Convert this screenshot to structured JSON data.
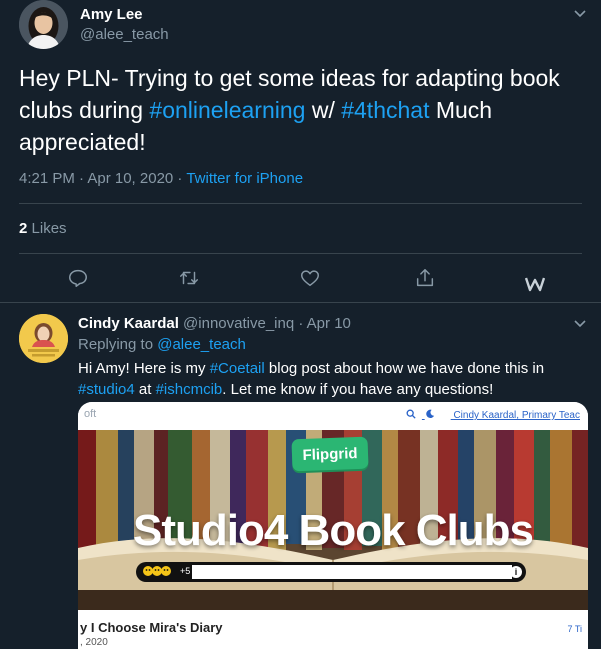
{
  "main_tweet": {
    "author_name": "Amy Lee",
    "author_handle": "@alee_teach",
    "text_parts": [
      {
        "text": "Hey PLN- Trying to get some ideas for adapting book clubs during ",
        "type": "text"
      },
      {
        "text": "#onlinelearning",
        "type": "hashtag"
      },
      {
        "text": " w/ ",
        "type": "text"
      },
      {
        "text": "#4thchat",
        "type": "hashtag"
      },
      {
        "text": " Much appreciated!",
        "type": "text"
      }
    ],
    "time": "4:21 PM · Apr 10, 2020",
    "separator": " · ",
    "source": "Twitter for iPhone",
    "likes_count": "2",
    "likes_label": "Likes",
    "actions": [
      "reply-icon",
      "retweet-icon",
      "like-icon",
      "share-icon",
      "wordpress-icon"
    ]
  },
  "reply_tweet": {
    "author_name": "Cindy Kaardal",
    "handle_and_date": "@innovative_inq · Apr 10",
    "replying_prefix": "Replying to",
    "replying_to": "@alee_teach",
    "text_parts": [
      {
        "text": "Hi Amy! Here is my ",
        "type": "text"
      },
      {
        "text": "#Coetail",
        "type": "hashtag"
      },
      {
        "text": " blog post about how we have done this in ",
        "type": "text"
      },
      {
        "text": "#studio4",
        "type": "hashtag"
      },
      {
        "text": " at ",
        "type": "text"
      },
      {
        "text": "#ishcmcib",
        "type": "hashtag"
      },
      {
        "text": ". Let me know if you have any questions!",
        "type": "text"
      }
    ],
    "card": {
      "corner_text": "oft",
      "user_link": "Cindy Kaardal, Primary Teac",
      "badge": "Flipgrid",
      "hero_title": "Studio4 Book Clubs",
      "video_count": "+5",
      "post_title": "y I Choose Mira's Diary",
      "post_date": ", 2020",
      "post_right": "7 Ti"
    }
  },
  "colors": {
    "background": "#15202b",
    "accent": "#1da1f2",
    "muted": "#8899a6",
    "border": "#38444d"
  }
}
